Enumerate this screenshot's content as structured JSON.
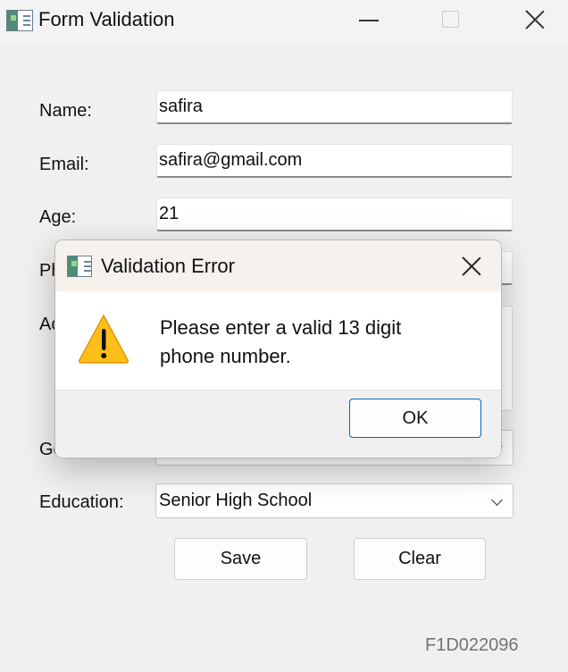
{
  "window": {
    "title": "Form Validation",
    "icon": "form-app-icon"
  },
  "form": {
    "name_label": "Name:",
    "name_value": "safira",
    "email_label": "Email:",
    "email_value": "safira@gmail.com",
    "age_label": "Age:",
    "age_value": "21",
    "phone_label_visible": "Ph",
    "address_label_visible": "Ac",
    "gender_label_visible": "Ge",
    "education_label": "Education:",
    "education_value": "Senior High School",
    "save_label": "Save",
    "clear_label": "Clear",
    "footer_id": "F1D022096"
  },
  "dialog": {
    "title": "Validation Error",
    "message_line_1": "Please enter a valid 13 digit",
    "message_line_2": "phone number.",
    "ok_label": "OK",
    "icon": "warning-icon"
  },
  "colors": {
    "window_background": "#f0f0f0",
    "dialog_title_background": "#f7f1ed",
    "dialog_button_border": "#0067c0",
    "warning_fill": "#ffbf1a"
  }
}
